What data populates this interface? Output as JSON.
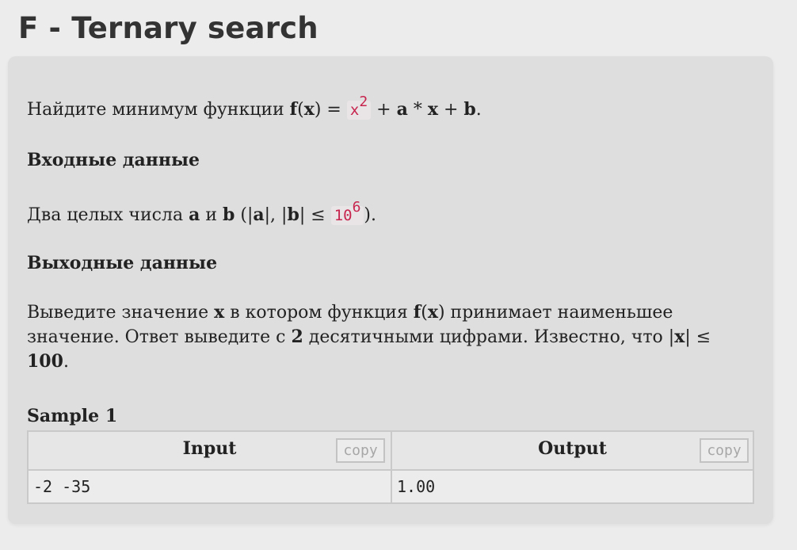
{
  "header": {
    "title": "F - Ternary search"
  },
  "statement": {
    "p1": {
      "t1": "Найдите минимум функции ",
      "f": "f",
      "t2": "(",
      "x1": "x",
      "t3": ") = ",
      "code_base": "x",
      "code_exp": "2",
      "t4": " + ",
      "a": "a",
      "t5": " * ",
      "x2": "x",
      "t6": " + ",
      "b": "b",
      "t7": "."
    },
    "input_heading": "Входные данные",
    "p2": {
      "t1": "Два целых числа ",
      "a": "a",
      "t2": " и ",
      "b": "b",
      "t3": " (|",
      "a2": "a",
      "t4": "|, |",
      "b2": "b",
      "t5": "| ≤ ",
      "code_base": "10",
      "code_exp": "6",
      "t6": ")."
    },
    "output_heading": "Выходные данные",
    "p3": {
      "t1": "Выведите значение ",
      "x": "x",
      "t2": " в котором функция ",
      "f": "f",
      "t3": "(",
      "x2": "x",
      "t4": ") принимает наименьшее значение. Ответ выведите с ",
      "n": "2",
      "t5": " десятичными цифрами. Известно, что |",
      "x3": "x",
      "t6": "| ≤ ",
      "lim": "100",
      "t7": "."
    }
  },
  "sample": {
    "label": "Sample 1",
    "input_header": "Input",
    "output_header": "Output",
    "copy_label": "copy",
    "input_value": "-2 -35",
    "output_value": "1.00"
  },
  "colors": {
    "background": "#ececec",
    "panel": "#dedede",
    "code_text": "#c7254e",
    "border": "#c9c9c9"
  }
}
